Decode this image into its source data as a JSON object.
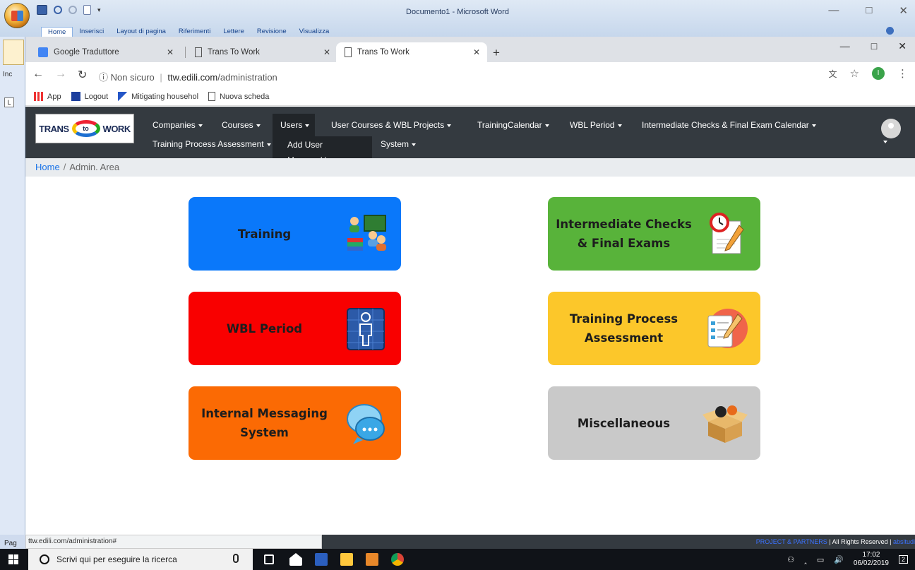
{
  "word": {
    "title": "Documento1 - Microsoft Word",
    "ribbon_tabs": [
      "Home",
      "Inserisci",
      "Layout di pagina",
      "Riferimenti",
      "Lettere",
      "Revisione",
      "Visualizza"
    ],
    "left_label": "Inc",
    "ruler_marker": "L",
    "status_stub": "Pag"
  },
  "browser": {
    "tabs": [
      {
        "title": "Google Traduttore",
        "active": false
      },
      {
        "title": "Trans To Work",
        "active": false
      },
      {
        "title": "Trans To Work",
        "active": true
      }
    ],
    "security_label": "Non sicuro",
    "url_host": "ttw.edili.com",
    "url_path": "/administration",
    "profile_initial": "I",
    "bookmarks": [
      "App",
      "Logout",
      "Mitigating househol",
      "Nuova scheda"
    ],
    "status_url": "ttw.edili.com/administration#"
  },
  "site": {
    "logo": {
      "left": "TRANS",
      "middle": "to",
      "right": "WORK"
    },
    "nav": {
      "companies": "Companies",
      "courses": "Courses",
      "users": "Users",
      "user_courses": "User Courses & WBL Projects",
      "training_calendar": "TrainingCalendar",
      "wbl_period": "WBL Period",
      "checks_calendar": "Intermediate Checks & Final Exam Calendar",
      "training_process": "Training Process Assessment",
      "system": "System"
    },
    "users_dropdown": [
      "Add User",
      "Manage User"
    ],
    "breadcrumb": {
      "home": "Home",
      "separator": "/",
      "current": "Admin. Area"
    },
    "cards": [
      {
        "line1": "Training",
        "line2": "",
        "color": "#0a78fa",
        "icon": "training-icon"
      },
      {
        "line1": "Intermediate Checks",
        "line2": "& Final Exams",
        "color": "#58b33a",
        "icon": "exam-clock-icon"
      },
      {
        "line1": "WBL Period",
        "line2": "",
        "color": "#f90000",
        "icon": "worker-icon"
      },
      {
        "line1": "Training Process",
        "line2": "Assessment",
        "color": "#fcc72a",
        "icon": "assessment-icon"
      },
      {
        "line1": "Internal Messaging",
        "line2": "System",
        "color": "#fb6a04",
        "icon": "chat-bubbles-icon"
      },
      {
        "line1": "Miscellaneous",
        "line2": "",
        "color": "#c9c9c9",
        "icon": "box-icon"
      }
    ],
    "footer": {
      "partners": "PROJECT & PARTNERS",
      "rights": " | All Rights Reserved | ",
      "tail": "absitudi"
    }
  },
  "taskbar": {
    "search_placeholder": "Scrivi qui per eseguire la ricerca",
    "time": "17:02",
    "date": "06/02/2019",
    "notifications": "2"
  }
}
